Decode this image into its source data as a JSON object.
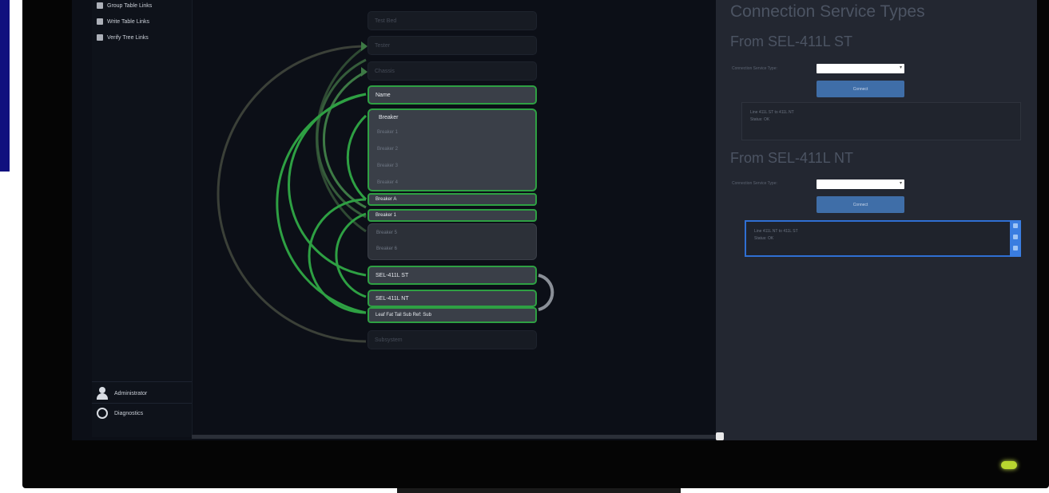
{
  "colors": {
    "accent_green": "#2ea043",
    "button_blue": "#3f6ea8",
    "panel_bg": "#232731",
    "screen_bg": "#0c0f17",
    "power_led": "#b9d630"
  },
  "sidebar": {
    "items": [
      {
        "label": "Group Table Links",
        "icon": "table-icon"
      },
      {
        "label": "Write Table Links",
        "icon": "table-icon"
      },
      {
        "label": "Verify Tree Links",
        "icon": "tree-icon"
      }
    ],
    "bottom": [
      {
        "label": "Administrator",
        "icon": "user-icon"
      },
      {
        "label": "Diagnostics",
        "icon": "diagnostics-icon"
      }
    ]
  },
  "diagram": {
    "dim_nodes": [
      "Test Bed",
      "Tester",
      "Chassis"
    ],
    "active_node": "Name",
    "group_title": "Breaker",
    "group_subs": [
      "Breaker 1",
      "Breaker 2",
      "Breaker 3",
      "Breaker 4"
    ],
    "chips": [
      "Breaker A",
      "Breaker 1"
    ],
    "group2_subs": [
      "Breaker 5",
      "Breaker 6"
    ],
    "bottom_nodes": [
      "SEL-411L ST",
      "SEL-411L NT",
      "Leaf Fat Tail Sub Ref: Sub"
    ],
    "last_dim": "Subsystem"
  },
  "panel": {
    "title": "Connection Service Types",
    "sections": [
      {
        "heading": "From SEL-411L ST",
        "field_label": "Connection Service Type:",
        "select_value": "",
        "button_label": "Connect",
        "result_lines": [
          "Line 411L ST to 411L NT",
          "Status: OK"
        ]
      },
      {
        "heading": "From SEL-411L NT",
        "field_label": "Connection Service Type:",
        "select_value": "",
        "button_label": "Connect",
        "result_lines": [
          "Line 411L NT to 411L ST",
          "Status: OK"
        ]
      }
    ]
  }
}
